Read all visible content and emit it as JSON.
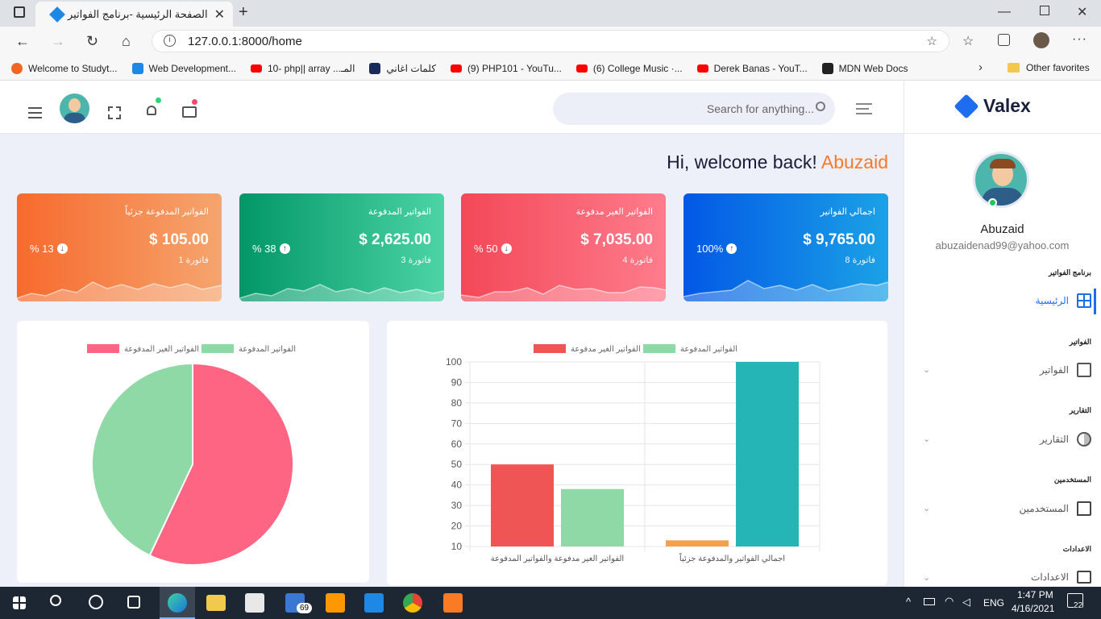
{
  "browser": {
    "tab_title": "الصفحة الرئيسية -برنامج الفواتير",
    "url": "127.0.0.1:8000/home",
    "bookmarks": [
      {
        "label": "Welcome to Studyt...",
        "icon": "studytonight-icon",
        "color": "#f26522"
      },
      {
        "label": "Web Development...",
        "icon": "udemy-icon",
        "color": "#1e88e5"
      },
      {
        "label": "10- php|| array ...المـ",
        "icon": "youtube-icon",
        "color": "#ff0000"
      },
      {
        "label": "كلمات اغاني",
        "icon": "k-icon",
        "color": "#1a2a5a"
      },
      {
        "label": "(9) PHP101 - YouTu...",
        "icon": "youtube-icon",
        "color": "#ff0000"
      },
      {
        "label": "(6) College Music ·...",
        "icon": "youtube-icon",
        "color": "#ff0000"
      },
      {
        "label": "Derek Banas - YouT...",
        "icon": "youtube-icon",
        "color": "#ff0000"
      },
      {
        "label": "MDN Web Docs",
        "icon": "mdn-icon",
        "color": "#222222"
      }
    ],
    "other_favorites": "Other favorites"
  },
  "header": {
    "search_placeholder": "Search for anything..."
  },
  "welcome": {
    "greeting": "Hi, welcome back!",
    "name": "Abuzaid"
  },
  "cards": [
    {
      "title": "الفواتير المدفوعة جزئياً",
      "value": "$ 105.00",
      "count": "1 فاتورة",
      "percent": "% 13",
      "trend": "down",
      "color_from": "#f76a2d",
      "color_to": "#f5a56e"
    },
    {
      "title": "الفواتير المدفوعة",
      "value": "$ 2,625.00",
      "count": "3 فاتورة",
      "percent": "% 38",
      "trend": "up",
      "color_from": "#029666",
      "color_to": "#4cd4a6"
    },
    {
      "title": "الفواتير الغير مدفوعة",
      "value": "$ 7,035.00",
      "count": "4 فاتورة",
      "percent": "% 50",
      "trend": "down",
      "color_from": "#f34858",
      "color_to": "#fe7c8c"
    },
    {
      "title": "اجمالي الفواتير",
      "value": "$ 9,765.00",
      "count": "8 فاتورة",
      "percent": "100%",
      "trend": "up",
      "color_from": "#0258e5",
      "color_to": "#1ba2e6"
    }
  ],
  "chart_data": [
    {
      "type": "pie",
      "legend": [
        "الفواتير المدفوعة",
        "الفواتير الغير المدفوعة"
      ],
      "series": [
        {
          "name": "الفواتير المدفوعة",
          "value": 43,
          "color": "#8fd9a6"
        },
        {
          "name": "الفواتير الغير المدفوعة",
          "value": 57,
          "color": "#fe6583"
        }
      ]
    },
    {
      "type": "bar",
      "categories": [
        "الفواتير الغير  مدفوعة والفواتير المدفوعة",
        "اجمالي الفواتير والمدفوعة جزئياً"
      ],
      "legend": [
        "الفواتير المدفوعة",
        "الفواتير الغير مدفوعة"
      ],
      "series": [
        {
          "name": "الفواتير الغير مدفوعة",
          "values": [
            50,
            null
          ],
          "color": "#f05555"
        },
        {
          "name": "الفواتير المدفوعة",
          "values": [
            38,
            null
          ],
          "color": "#8fd9a6"
        },
        {
          "name": "",
          "values": [
            null,
            13
          ],
          "color": "#f5a04a"
        },
        {
          "name": "",
          "values": [
            null,
            100
          ],
          "color": "#26b5b7"
        }
      ],
      "y_ticks": [
        10,
        20,
        30,
        40,
        50,
        60,
        70,
        80,
        90,
        100
      ],
      "ylim": [
        10,
        100
      ]
    }
  ],
  "sidebar": {
    "brand": "Valex",
    "user_name": "Abuzaid",
    "user_email": "abuzaidenad99@yahoo.com",
    "sections": [
      {
        "title": "برنامج الفواتير",
        "item": "الرئيسية",
        "icon": "dashboard-icon",
        "active": true
      },
      {
        "title": "الفواتير",
        "item": "الفواتير",
        "icon": "bar-chart-icon",
        "active": false
      },
      {
        "title": "التقارير",
        "item": "التقارير",
        "icon": "pie-icon",
        "active": false
      },
      {
        "title": "المستخدمين",
        "item": "المستخدمين",
        "icon": "chat-icon",
        "active": false
      },
      {
        "title": "الاعدادات",
        "item": "الاعدادات",
        "icon": "book-icon",
        "active": false
      }
    ]
  },
  "taskbar": {
    "time": "1:47 PM",
    "date": "4/16/2021",
    "lang": "ENG",
    "mail_badge": "69",
    "notif_count": "22"
  }
}
